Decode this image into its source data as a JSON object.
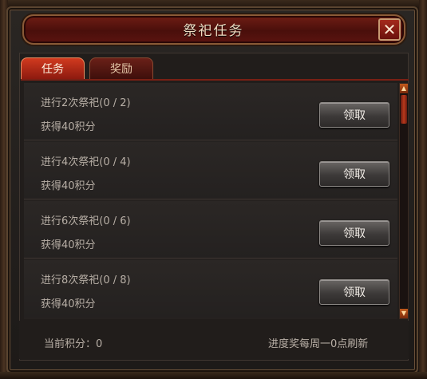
{
  "window": {
    "title": "祭祀任务",
    "close_label": "✕"
  },
  "tabs": [
    {
      "label": "任务",
      "active": true
    },
    {
      "label": "奖励",
      "active": false
    }
  ],
  "tasks": [
    {
      "task": "进行2次祭祀(0 / 2)",
      "reward": "获得40积分",
      "button": "领取"
    },
    {
      "task": "进行4次祭祀(0 / 4)",
      "reward": "获得40积分",
      "button": "领取"
    },
    {
      "task": "进行6次祭祀(0 / 6)",
      "reward": "获得40积分",
      "button": "领取"
    },
    {
      "task": "进行8次祭祀(0 / 8)",
      "reward": "获得40积分",
      "button": "领取"
    }
  ],
  "footer": {
    "points_text": "当前积分：0",
    "refresh_text": "进度奖每周一0点刷新"
  },
  "colors": {
    "title_red": "#5b1410",
    "tab_active": "#d13a1f",
    "text": "#b8afa6"
  }
}
